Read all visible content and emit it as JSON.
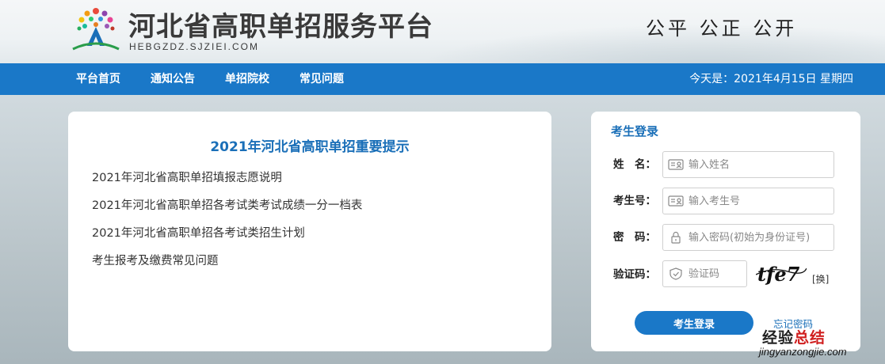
{
  "header": {
    "site_title": "河北省高职单招服务平台",
    "site_url": "HEBGZDZ.SJZIEI.COM",
    "slogan": "公平 公正 公开"
  },
  "nav": {
    "items": [
      {
        "label": "平台首页"
      },
      {
        "label": "通知公告"
      },
      {
        "label": "单招院校"
      },
      {
        "label": "常见问题"
      }
    ],
    "date_text": "今天是：2021年4月15日 星期四"
  },
  "notice": {
    "title": "2021年河北省高职单招重要提示",
    "items": [
      {
        "label": "2021年河北省高职单招填报志愿说明"
      },
      {
        "label": "2021年河北省高职单招各考试类考试成绩一分一档表"
      },
      {
        "label": "2021年河北省高职单招各考试类招生计划"
      },
      {
        "label": "考生报考及缴费常见问题"
      }
    ]
  },
  "login": {
    "title": "考生登录",
    "name_label": "姓　名：",
    "name_placeholder": "输入姓名",
    "exam_no_label": "考生号：",
    "exam_no_placeholder": "输入考生号",
    "password_label": "密　码：",
    "password_placeholder": "输入密码(初始为身份证号)",
    "captcha_label": "验证码：",
    "captcha_placeholder": "验证码",
    "captcha_text": "tfe7",
    "captcha_change": "[换]",
    "submit_label": "考生登录",
    "forgot_label": "忘记密码"
  },
  "watermark": {
    "main_left": "经验",
    "main_right": "总结",
    "sub": "jingyanzongjie.com"
  },
  "colors": {
    "nav_bg": "#1a78c8",
    "title_blue": "#1a6fb8"
  }
}
